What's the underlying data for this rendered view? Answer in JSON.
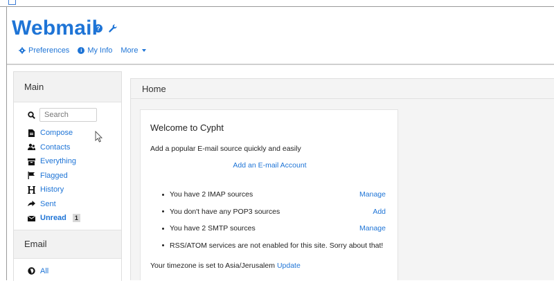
{
  "header": {
    "title": "Webmail",
    "help_icon": "question-circle",
    "settings_icon": "wrench"
  },
  "topnav": {
    "items": [
      {
        "label": "Preferences",
        "icon": "gear"
      },
      {
        "label": "My Info",
        "icon": "info-circle"
      },
      {
        "label": "More",
        "icon": "caret-down"
      }
    ]
  },
  "sidebar": {
    "main_title": "Main",
    "search_placeholder": "Search",
    "items": [
      {
        "label": "Compose",
        "icon": "compose-doc"
      },
      {
        "label": "Contacts",
        "icon": "users"
      },
      {
        "label": "Everything",
        "icon": "box"
      },
      {
        "label": "Flagged",
        "icon": "flag"
      },
      {
        "label": "History",
        "icon": "h-letter"
      },
      {
        "label": "Sent",
        "icon": "arrow-right"
      },
      {
        "label": "Unread",
        "icon": "envelope",
        "badge": "1"
      }
    ],
    "email_title": "Email",
    "email_items": [
      {
        "label": "All",
        "icon": "globe"
      }
    ]
  },
  "main": {
    "title": "Home",
    "welcome": {
      "title": "Welcome to Cypht",
      "subtitle": "Add a popular E-mail source quickly and easily",
      "add_link": "Add an E-mail Account",
      "rows": [
        {
          "text": "You have 2 IMAP sources",
          "action": "Manage"
        },
        {
          "text": "You don't have any POP3 sources",
          "action": "Add"
        },
        {
          "text": "You have 2 SMTP sources",
          "action": "Manage"
        },
        {
          "text": "RSS/ATOM services are not enabled for this site. Sorry about that!",
          "action": ""
        }
      ],
      "timezone_text": "Your timezone is set to Asia/Jerusalem",
      "timezone_action": "Update"
    }
  },
  "colors": {
    "accent": "#1e74d6",
    "panel": "#f2f2f2"
  }
}
